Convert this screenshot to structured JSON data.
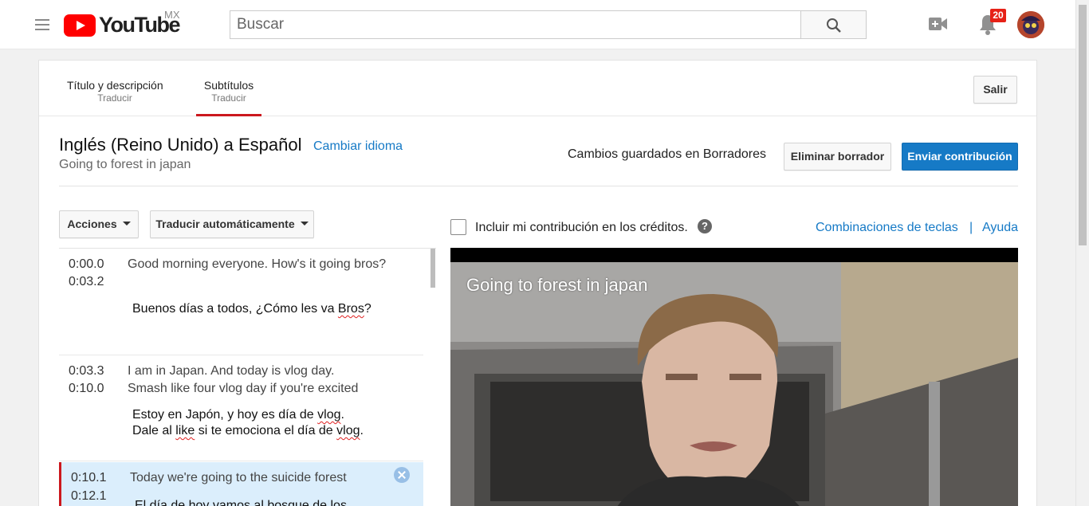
{
  "header": {
    "logo_text": "YouTube",
    "region": "MX",
    "search_placeholder": "Buscar",
    "notification_count": "20"
  },
  "tabs": [
    {
      "label": "Título y descripción",
      "sub": "Traducir"
    },
    {
      "label": "Subtítulos",
      "sub": "Traducir",
      "active": true
    }
  ],
  "exit_label": "Salir",
  "editor": {
    "title": "Inglés (Reino Unido) a Español",
    "change_language": "Cambiar idioma",
    "video_title": "Going to forest in japan",
    "saved_status": "Cambios guardados en Borradores",
    "delete_draft": "Eliminar borrador",
    "submit": "Enviar contribución"
  },
  "toolbar": {
    "actions": "Acciones",
    "auto_translate": "Traducir automáticamente"
  },
  "captions": [
    {
      "start": "0:00.0",
      "end": "0:03.2",
      "source": "Good morning everyone. How's it going bros?",
      "translation_parts": [
        "Buenos días a todos, ¿Cómo les va ",
        "Bros",
        "?"
      ]
    },
    {
      "start": "0:03.3",
      "end": "0:10.0",
      "source_line1": "I am in Japan. And today is vlog day.",
      "source_line2": "Smash like four vlog day if you're excited",
      "translation_line1_parts": [
        "Estoy en Japón, y hoy es día de ",
        "vlog",
        "."
      ],
      "translation_line2_parts": [
        "Dale al ",
        "like",
        " si te emociona el día de ",
        "vlog",
        "."
      ]
    },
    {
      "start": "0:10.1",
      "end": "0:12.1",
      "source": "Today we're going to the suicide forest",
      "translation": "El día de hoy vamos al bosque de los",
      "active": true
    }
  ],
  "credits_label": "Incluir mi contribución en los créditos.",
  "help_symbol": "?",
  "links": {
    "shortcuts": "Combinaciones de teclas",
    "separator": "|",
    "help": "Ayuda"
  },
  "player": {
    "title": "Going to forest in japan"
  },
  "colors": {
    "brand_red": "#ff0000",
    "link_blue": "#167ac6",
    "active_row": "#dbeefc",
    "tab_underline": "#cc181e"
  }
}
